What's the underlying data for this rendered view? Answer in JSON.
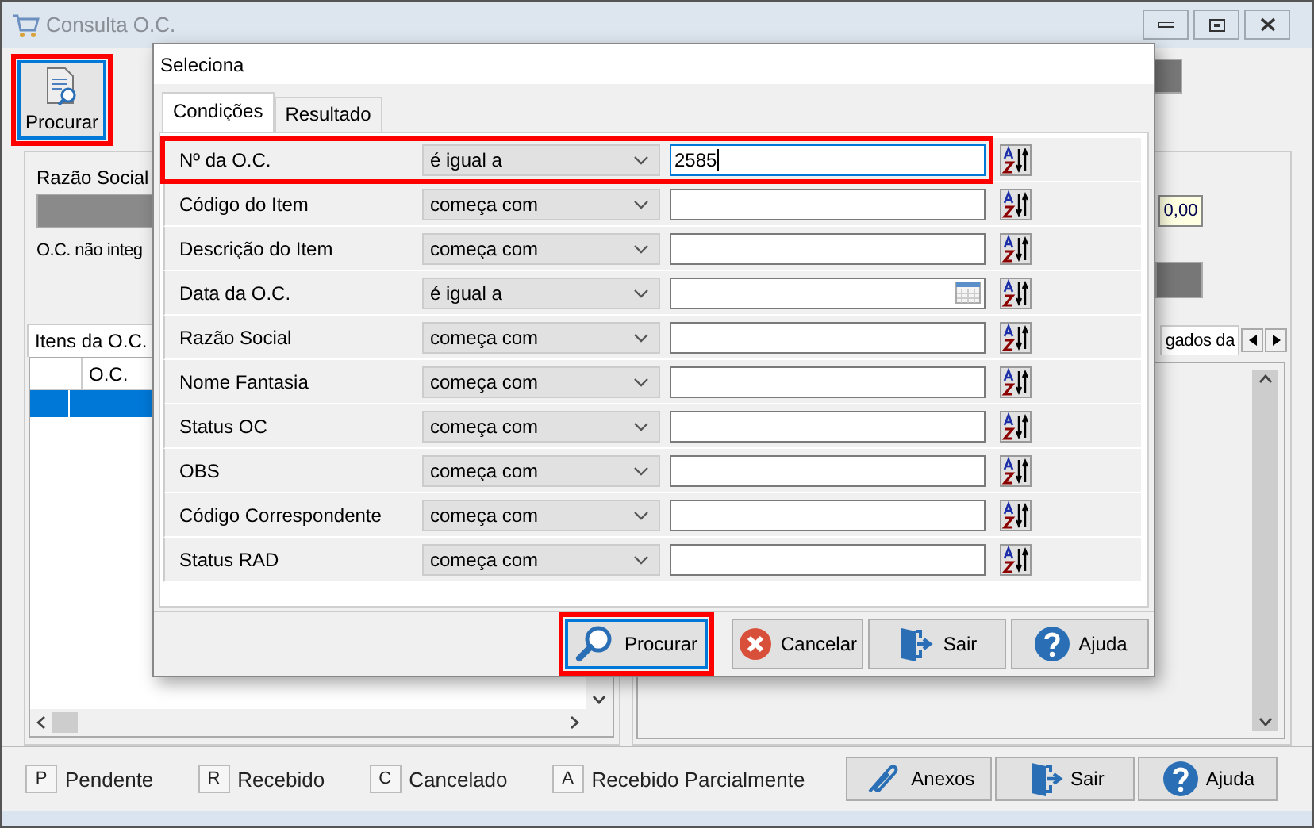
{
  "window": {
    "title": "Consulta O.C."
  },
  "toolbar": {
    "buttons": [
      {
        "label": "Procurar",
        "highlighted": true
      }
    ]
  },
  "header": {
    "razao_social_label": "Razão Social",
    "integration_note": "O.C. não integ",
    "amount": "0,00"
  },
  "left_tab": {
    "label": "Itens da O.C."
  },
  "right_tab": {
    "label": "gados da"
  },
  "items_grid": {
    "columns": [
      "O.C."
    ],
    "rows": [
      {
        "selected": true
      }
    ]
  },
  "legend": [
    {
      "key": "P",
      "label": "Pendente"
    },
    {
      "key": "R",
      "label": "Recebido"
    },
    {
      "key": "C",
      "label": "Cancelado"
    },
    {
      "key": "A",
      "label": "Recebido Parcialmente"
    }
  ],
  "bottom_buttons": [
    {
      "label": "Anexos",
      "kind": "attach"
    },
    {
      "label": "Sair",
      "kind": "exit"
    },
    {
      "label": "Ajuda",
      "kind": "help"
    }
  ],
  "dialog": {
    "title": "Seleciona",
    "tabs": [
      {
        "label": "Condições",
        "selected": true
      },
      {
        "label": "Resultado",
        "selected": false
      }
    ],
    "conditions": [
      {
        "field": "Nº da O.C.",
        "operator": "é igual a",
        "value": "2585",
        "kind": "text",
        "highlighted": true,
        "focused": true
      },
      {
        "field": "Código do Item",
        "operator": "começa com",
        "kind": "text",
        "highlighted": false,
        "focused": false
      },
      {
        "field": "Descrição do Item",
        "operator": "começa com",
        "kind": "text",
        "highlighted": false,
        "focused": false
      },
      {
        "field": "Data da O.C.",
        "operator": "é igual a",
        "kind": "date",
        "highlighted": false,
        "focused": false
      },
      {
        "field": "Razão Social",
        "operator": "começa com",
        "kind": "text",
        "highlighted": false,
        "focused": false
      },
      {
        "field": "Nome Fantasia",
        "operator": "começa com",
        "kind": "text",
        "highlighted": false,
        "focused": false
      },
      {
        "field": "Status OC",
        "operator": "começa com",
        "kind": "text",
        "highlighted": false,
        "focused": false
      },
      {
        "field": "OBS",
        "operator": "começa com",
        "kind": "text",
        "highlighted": false,
        "focused": false
      },
      {
        "field": "Código Correspondente",
        "operator": "começa com",
        "kind": "text",
        "highlighted": false,
        "focused": false
      },
      {
        "field": "Status RAD",
        "operator": "começa com",
        "kind": "text",
        "highlighted": false,
        "focused": false
      }
    ],
    "buttons": [
      {
        "label": "Procurar",
        "kind": "search",
        "highlighted": true
      },
      {
        "label": "Cancelar",
        "kind": "cancel",
        "highlighted": false
      },
      {
        "label": "Sair",
        "kind": "exit",
        "highlighted": false
      },
      {
        "label": "Ajuda",
        "kind": "help",
        "highlighted": false
      }
    ]
  }
}
